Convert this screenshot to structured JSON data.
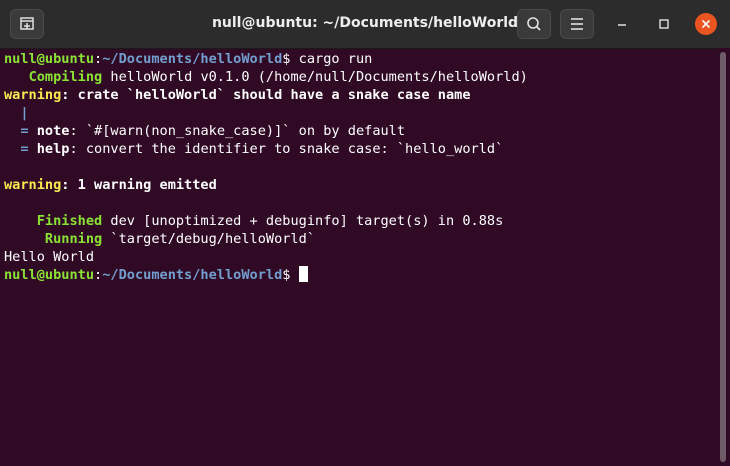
{
  "window": {
    "title": "null@ubuntu: ~/Documents/helloWorld"
  },
  "toolbar": {
    "new_tab_icon": "new-tab-icon",
    "search_icon": "search-icon",
    "menu_icon": "hamburger-menu-icon",
    "minimize_icon": "minimize-icon",
    "maximize_icon": "maximize-icon",
    "close_icon": "close-icon"
  },
  "colors": {
    "terminal_bg": "#300a24",
    "prompt_user": "#8ae234",
    "prompt_path": "#729fcf",
    "warning": "#fce94f",
    "close_button": "#e95420"
  },
  "terminal": {
    "prompt1_user": "null@ubuntu",
    "prompt1_colon": ":",
    "prompt1_path": "~/Documents/helloWorld",
    "prompt1_dollar": "$ ",
    "prompt1_command": "cargo run",
    "compiling_label": "Compiling",
    "compiling_text": " helloWorld v0.1.0 (/home/null/Documents/helloWorld)",
    "warning_label": "warning",
    "warning_text": ": crate `helloWorld` should have a snake case name",
    "pipe": "|",
    "eq1": "=",
    "note_label": "note",
    "note_text": ": `#[warn(non_snake_case)]` on by default",
    "eq2": "=",
    "help_label": "help",
    "help_text": ": convert the identifier to snake case: `hello_world`",
    "warning2_label": "warning",
    "warning2_text": ": 1 warning emitted",
    "finished_label": "Finished",
    "finished_text": " dev [unoptimized + debuginfo] target(s) in 0.88s",
    "running_label": "Running",
    "running_text": " `target/debug/helloWorld`",
    "program_output": "Hello World",
    "prompt2_user": "null@ubuntu",
    "prompt2_colon": ":",
    "prompt2_path": "~/Documents/helloWorld",
    "prompt2_dollar": "$ "
  }
}
